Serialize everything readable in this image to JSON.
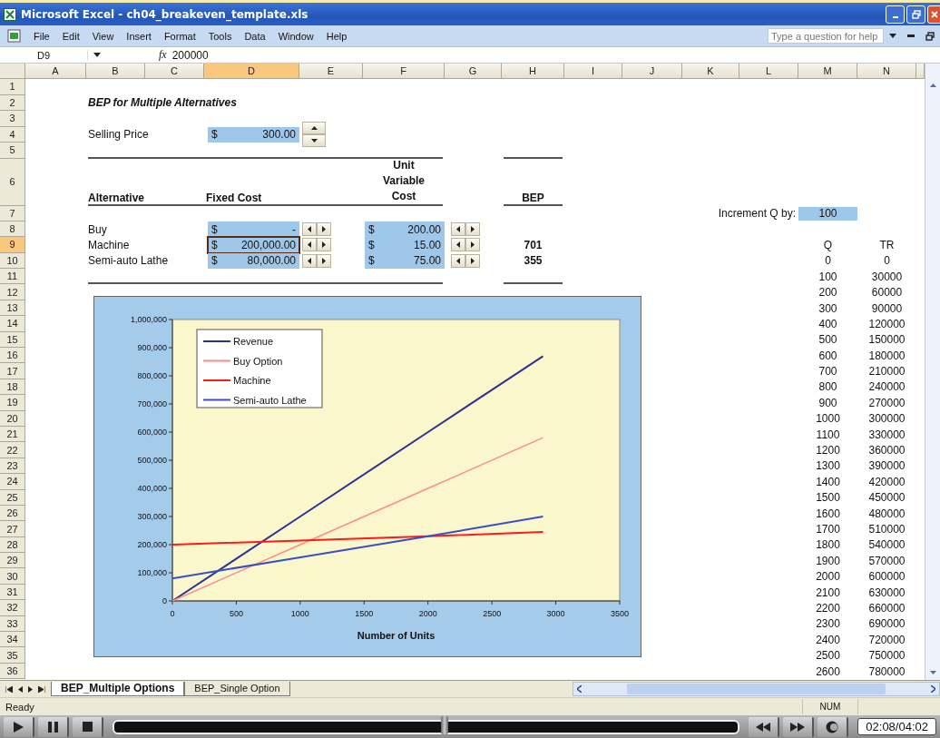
{
  "window": {
    "title": "Microsoft Excel - ch04_breakeven_template.xls"
  },
  "menu": [
    "File",
    "Edit",
    "View",
    "Insert",
    "Format",
    "Tools",
    "Data",
    "Window",
    "Help"
  ],
  "help_box": {
    "placeholder": "Type a question for help"
  },
  "formula_bar": {
    "name_box": "D9",
    "fx": "fx",
    "formula": "200000"
  },
  "columns": [
    {
      "label": "A",
      "selected": false
    },
    {
      "label": "B",
      "selected": false
    },
    {
      "label": "C",
      "selected": false
    },
    {
      "label": "D",
      "selected": true
    },
    {
      "label": "E",
      "selected": false
    },
    {
      "label": "F",
      "selected": false
    },
    {
      "label": "G",
      "selected": false
    },
    {
      "label": "H",
      "selected": false
    },
    {
      "label": "I",
      "selected": false
    },
    {
      "label": "J",
      "selected": false
    },
    {
      "label": "K",
      "selected": false
    },
    {
      "label": "L",
      "selected": false
    },
    {
      "label": "M",
      "selected": false
    },
    {
      "label": "N",
      "selected": false
    }
  ],
  "rows": [
    {
      "label": "1",
      "selected": false
    },
    {
      "label": "2",
      "selected": false
    },
    {
      "label": "3",
      "selected": false
    },
    {
      "label": "4",
      "selected": false
    },
    {
      "label": "5",
      "selected": false
    },
    {
      "label": "6",
      "selected": false
    },
    {
      "label": "7",
      "selected": false
    },
    {
      "label": "8",
      "selected": false
    },
    {
      "label": "9",
      "selected": true
    },
    {
      "label": "10",
      "selected": false
    },
    {
      "label": "11",
      "selected": false
    },
    {
      "label": "12",
      "selected": false
    },
    {
      "label": "13",
      "selected": false
    },
    {
      "label": "14",
      "selected": false
    },
    {
      "label": "15",
      "selected": false
    },
    {
      "label": "16",
      "selected": false
    },
    {
      "label": "17",
      "selected": false
    },
    {
      "label": "18",
      "selected": false
    },
    {
      "label": "19",
      "selected": false
    },
    {
      "label": "20",
      "selected": false
    },
    {
      "label": "21",
      "selected": false
    },
    {
      "label": "22",
      "selected": false
    },
    {
      "label": "23",
      "selected": false
    },
    {
      "label": "24",
      "selected": false
    },
    {
      "label": "25",
      "selected": false
    },
    {
      "label": "26",
      "selected": false
    },
    {
      "label": "27",
      "selected": false
    },
    {
      "label": "28",
      "selected": false
    },
    {
      "label": "29",
      "selected": false
    },
    {
      "label": "30",
      "selected": false
    },
    {
      "label": "31",
      "selected": false
    },
    {
      "label": "32",
      "selected": false
    },
    {
      "label": "33",
      "selected": false
    },
    {
      "label": "34",
      "selected": false
    },
    {
      "label": "35",
      "selected": false
    },
    {
      "label": "36",
      "selected": false
    }
  ],
  "sheet": {
    "title": "BEP for Multiple Alternatives",
    "selling_price": {
      "label": "Selling Price",
      "currency": "$",
      "value": "300.00"
    },
    "headers": {
      "alternative": "Alternative",
      "fixed_cost": "Fixed Cost",
      "unit_variable_cost": "Unit Variable Cost",
      "bep": "BEP"
    },
    "alternatives": [
      {
        "name": "Buy",
        "fixed_cost": {
          "currency": "$",
          "value": "-",
          "selected": false
        },
        "variable_cost": {
          "currency": "$",
          "value": "200.00"
        }
      },
      {
        "name": "Machine",
        "fixed_cost": {
          "currency": "$",
          "value": "200,000.00",
          "selected": true
        },
        "variable_cost": {
          "currency": "$",
          "value": "15.00"
        },
        "bep": "701"
      },
      {
        "name": "Semi-auto Lathe",
        "fixed_cost": {
          "currency": "$",
          "value": "80,000.00",
          "selected": false
        },
        "variable_cost": {
          "currency": "$",
          "value": "75.00"
        },
        "bep": "355"
      }
    ],
    "increment": {
      "label": "Increment Q by:",
      "value": "100"
    },
    "q_table": {
      "headers": [
        "Q",
        "TR"
      ],
      "rows": [
        [
          "0",
          "0"
        ],
        [
          "100",
          "30000"
        ],
        [
          "200",
          "60000"
        ],
        [
          "300",
          "90000"
        ],
        [
          "400",
          "120000"
        ],
        [
          "500",
          "150000"
        ],
        [
          "600",
          "180000"
        ],
        [
          "700",
          "210000"
        ],
        [
          "800",
          "240000"
        ],
        [
          "900",
          "270000"
        ],
        [
          "1000",
          "300000"
        ],
        [
          "1100",
          "330000"
        ],
        [
          "1200",
          "360000"
        ],
        [
          "1300",
          "390000"
        ],
        [
          "1400",
          "420000"
        ],
        [
          "1500",
          "450000"
        ],
        [
          "1600",
          "480000"
        ],
        [
          "1700",
          "510000"
        ],
        [
          "1800",
          "540000"
        ],
        [
          "1900",
          "570000"
        ],
        [
          "2000",
          "600000"
        ],
        [
          "2100",
          "630000"
        ],
        [
          "2200",
          "660000"
        ],
        [
          "2300",
          "690000"
        ],
        [
          "2400",
          "720000"
        ],
        [
          "2500",
          "750000"
        ],
        [
          "2600",
          "780000"
        ]
      ]
    }
  },
  "chart": {
    "chart_data": {
      "type": "line",
      "xlabel": "Number of Units",
      "legend": true,
      "x": [
        0,
        1000,
        2000,
        2900
      ],
      "series": [
        {
          "name": "Revenue",
          "color": "#2e3192",
          "values": [
            0,
            300000,
            600000,
            870000
          ]
        },
        {
          "name": "Buy Option",
          "color": "#ff8a8a",
          "values": [
            0,
            200000,
            400000,
            580000
          ]
        },
        {
          "name": "Machine",
          "color": "#ff1a1a",
          "values": [
            200000,
            215000,
            230000,
            245000
          ]
        },
        {
          "name": "Semi-auto Lathe",
          "color": "#3b4fc4",
          "values": [
            80000,
            155000,
            230000,
            300000
          ]
        }
      ],
      "xlim": [
        0,
        3500
      ],
      "ylim": [
        0,
        1000000
      ],
      "xticks": [
        0,
        500,
        1000,
        1500,
        2000,
        2500,
        3000,
        3500
      ],
      "yticks": [
        {
          "value": 0,
          "label": "0"
        },
        {
          "value": 100000,
          "label": "100,000"
        },
        {
          "value": 200000,
          "label": "200,000"
        },
        {
          "value": 300000,
          "label": "300,000"
        },
        {
          "value": 400000,
          "label": "400,000"
        },
        {
          "value": 500000,
          "label": "500,000"
        },
        {
          "value": 600000,
          "label": "600,000"
        },
        {
          "value": 700000,
          "label": "700,000"
        },
        {
          "value": 800000,
          "label": "800,000"
        },
        {
          "value": 900000,
          "label": "900,000"
        },
        {
          "value": 1000000,
          "label": "1,000,000"
        }
      ]
    }
  },
  "sheet_tabs": [
    {
      "label": "BEP_Multiple Options",
      "selected": true
    },
    {
      "label": "BEP_Single Option",
      "selected": false
    }
  ],
  "status_bar": {
    "status": "Ready",
    "indicator": "NUM"
  },
  "player": {
    "seek": {
      "level": 0.53
    },
    "time": "02:08/04:02"
  }
}
